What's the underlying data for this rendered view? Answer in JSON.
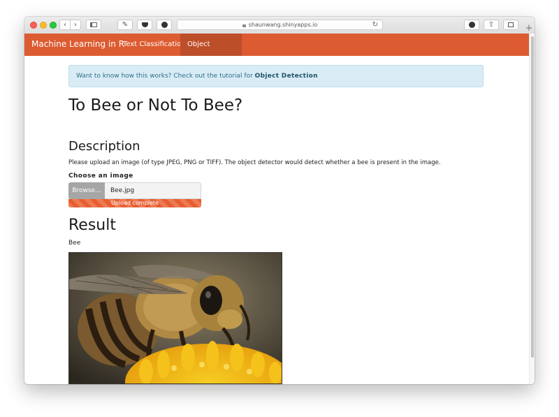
{
  "browser": {
    "url": "shaunwang.shinyapps.io"
  },
  "navbar": {
    "brand": "Machine Learning in R",
    "items": [
      {
        "label": "Text Classification",
        "active": false
      },
      {
        "label": "Object Detection",
        "active": true
      }
    ]
  },
  "alert": {
    "text": "Want to know how this works? Check out the tutorial for ",
    "link": "Object Detection"
  },
  "page": {
    "title": "To Bee or Not To Bee?",
    "description_heading": "Description",
    "description": "Please upload an image (of type JPEG, PNG or TIFF). The object detector would detect whether a bee is present in the image.",
    "upload_label": "Choose an image",
    "browse_label": "Browse...",
    "file_name": "Bee.jpg",
    "upload_status": "Upload complete",
    "upload_progress": 1.0,
    "result_heading": "Result",
    "result_value": "Bee"
  },
  "colors": {
    "navbar": "#dd5b31",
    "navbar_active": "#bc4e2a",
    "alert_bg": "#d9ecf5",
    "progress": "#e85e30"
  },
  "icons": [
    "back-icon",
    "forward-icon",
    "sidebar-icon",
    "share-pencil-icon",
    "pocket-icon",
    "extension-icon",
    "lock-icon",
    "reload-icon",
    "download-icon",
    "share-icon",
    "tabs-icon",
    "new-tab-icon"
  ]
}
